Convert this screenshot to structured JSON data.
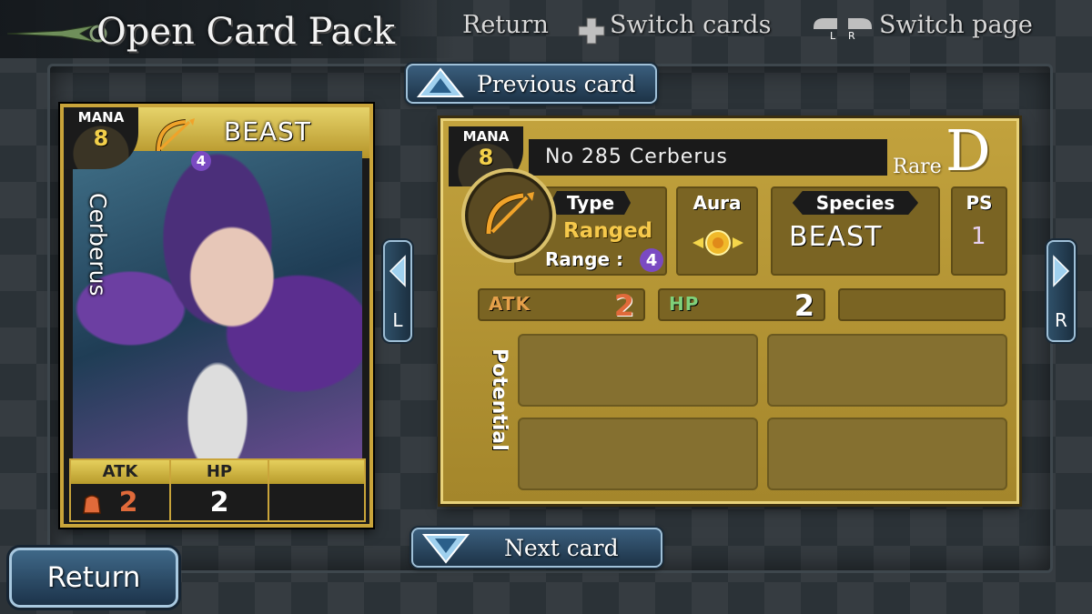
{
  "header": {
    "title": "Open Card Pack",
    "hints": {
      "return": "Return",
      "switch_cards": "Switch cards",
      "switch_page": "Switch page",
      "l_key": "L",
      "r_key": "R"
    }
  },
  "nav": {
    "previous": "Previous card",
    "next": "Next card",
    "left": "L",
    "right": "R",
    "return": "Return"
  },
  "card": {
    "mana_label": "MANA",
    "mana": "8",
    "range": "4",
    "species": "BEAST",
    "name": "Cerberus",
    "atk_label": "ATK",
    "hp_label": "HP",
    "atk": "2",
    "hp": "2"
  },
  "info": {
    "mana_label": "MANA",
    "mana": "8",
    "name": "No 285 Cerberus",
    "rare_label": "Rare",
    "rarity": "D",
    "type_label": "Type",
    "type": "Ranged",
    "range_label": "Range :",
    "range": "4",
    "aura_label": "Aura",
    "species_label": "Species",
    "species": "BEAST",
    "ps_label": "PS",
    "ps": "1",
    "atk_label": "ATK",
    "atk": "2",
    "hp_label": "HP",
    "hp": "2",
    "potential_label": "Potential"
  },
  "colors": {
    "gold": "#c2a23d",
    "atk_value": "#e06a3a",
    "atk_label": "#e5a04a",
    "hp_label": "#7fd17a",
    "range_badge": "#7a4ac2",
    "button_blue": "#3a5e7d"
  }
}
